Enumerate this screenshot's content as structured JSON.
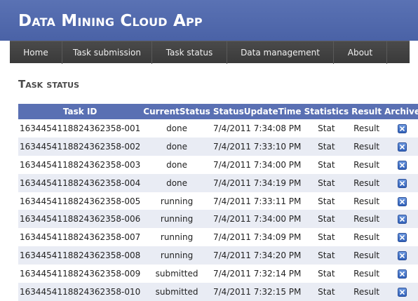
{
  "app": {
    "title": "Data Mining Cloud App"
  },
  "nav": [
    {
      "label": "Home"
    },
    {
      "label": "Task submission"
    },
    {
      "label": "Task status"
    },
    {
      "label": "Data management"
    },
    {
      "label": "About"
    }
  ],
  "page": {
    "title": "Task status"
  },
  "table": {
    "headers": [
      "Task ID",
      "CurrentStatus",
      "StatusUpdateTime",
      "Statistics",
      "Result",
      "Archive"
    ],
    "status_colors": {
      "done": "#2e7d1f",
      "running": "#1d3f8c",
      "submitted": "#e59b0f"
    },
    "archive_icon": "close-x-icon",
    "rows": [
      {
        "id": "1634454118824362358-001",
        "status": "done",
        "time": "7/4/2011 7:34:08 PM",
        "stat": "Stat",
        "result": "Result",
        "linked": true
      },
      {
        "id": "1634454118824362358-002",
        "status": "done",
        "time": "7/4/2011 7:33:10 PM",
        "stat": "Stat",
        "result": "Result",
        "linked": true
      },
      {
        "id": "1634454118824362358-003",
        "status": "done",
        "time": "7/4/2011 7:34:00 PM",
        "stat": "Stat",
        "result": "Result",
        "linked": true
      },
      {
        "id": "1634454118824362358-004",
        "status": "done",
        "time": "7/4/2011 7:34:19 PM",
        "stat": "Stat",
        "result": "Result",
        "linked": true
      },
      {
        "id": "1634454118824362358-005",
        "status": "running",
        "time": "7/4/2011 7:33:11 PM",
        "stat": "Stat",
        "result": "Result",
        "linked": false
      },
      {
        "id": "1634454118824362358-006",
        "status": "running",
        "time": "7/4/2011 7:34:00 PM",
        "stat": "Stat",
        "result": "Result",
        "linked": false
      },
      {
        "id": "1634454118824362358-007",
        "status": "running",
        "time": "7/4/2011 7:34:09 PM",
        "stat": "Stat",
        "result": "Result",
        "linked": false
      },
      {
        "id": "1634454118824362358-008",
        "status": "running",
        "time": "7/4/2011 7:34:20 PM",
        "stat": "Stat",
        "result": "Result",
        "linked": false
      },
      {
        "id": "1634454118824362358-009",
        "status": "submitted",
        "time": "7/4/2011 7:32:14 PM",
        "stat": "Stat",
        "result": "Result",
        "linked": false
      },
      {
        "id": "1634454118824362358-010",
        "status": "submitted",
        "time": "7/4/2011 7:32:15 PM",
        "stat": "Stat",
        "result": "Result",
        "linked": false
      }
    ]
  }
}
